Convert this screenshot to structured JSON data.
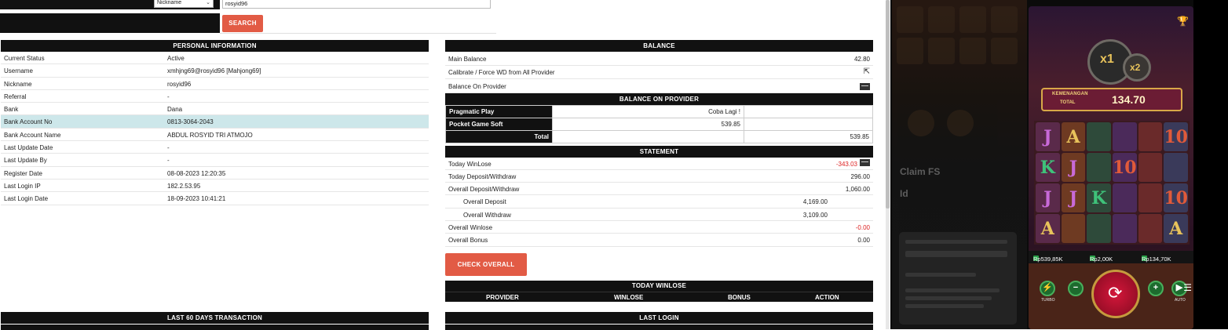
{
  "search": {
    "select_value": "Nickname",
    "input_value": "rosyid96",
    "button_label": "SEARCH"
  },
  "personal": {
    "title": "PERSONAL INFORMATION",
    "rows": [
      {
        "label": "Current Status",
        "value": "Active"
      },
      {
        "label": "Username",
        "value": "xmhjng69@rosyid96  [Mahjong69]"
      },
      {
        "label": "Nickname",
        "value": "rosyid96"
      },
      {
        "label": "Referral",
        "value": "-"
      },
      {
        "label": "Bank",
        "value": "Dana"
      },
      {
        "label": "Bank Account No",
        "value": "0813-3064-2043"
      },
      {
        "label": "Bank Account Name",
        "value": "ABDUL ROSYID TRI ATMOJO"
      },
      {
        "label": "Last Update Date",
        "value": "-"
      },
      {
        "label": "Last Update By",
        "value": "-"
      },
      {
        "label": "Register Date",
        "value": "08-08-2023 12:20:35"
      },
      {
        "label": "Last Login IP",
        "value": "182.2.53.95"
      },
      {
        "label": "Last Login Date",
        "value": "18-09-2023 10:41:21"
      }
    ]
  },
  "balance": {
    "title": "BALANCE",
    "main_label": "Main Balance",
    "main_value": "42.80",
    "calibrate_label": "Calibrate / Force WD from All Provider",
    "on_provider_label": "Balance On Provider",
    "provider_title": "BALANCE ON PROVIDER",
    "providers": [
      {
        "name": "Pragmatic Play",
        "value": "Coba Lagi !",
        "value2": ""
      },
      {
        "name": "Pocket Game Soft",
        "value": "539.85",
        "value2": ""
      }
    ],
    "total_label": "Total",
    "total_value": "539.85"
  },
  "statement": {
    "title": "STATEMENT",
    "today_winlose_label": "Today WinLose",
    "today_winlose_value": "-343.03",
    "today_dw_label": "Today Deposit/Withdraw",
    "today_dw_value": "296.00",
    "overall_dw_label": "Overall Deposit/Withdraw",
    "overall_dw_value": "1,060.00",
    "overall_deposit_label": "Overall Deposit",
    "overall_deposit_value": "4,169.00",
    "overall_withdraw_label": "Overall Withdraw",
    "overall_withdraw_value": "3,109.00",
    "overall_winlose_label": "Overall Winlose",
    "overall_winlose_value": "-0.00",
    "overall_bonus_label": "Overall Bonus",
    "overall_bonus_value": "0.00",
    "check_button": "CHECK OVERALL"
  },
  "today_winlose": {
    "title": "TODAY WINLOSE",
    "columns": [
      "PROVIDER",
      "WINLOSE",
      "BONUS",
      "ACTION"
    ]
  },
  "last60": {
    "title": "LAST 60 DAYS TRANSACTION"
  },
  "last_login": {
    "title": "LAST LOGIN"
  },
  "game": {
    "side_text_1": "Claim FS",
    "side_text_2": "Id",
    "multiplier": "x1",
    "multiplier2": "x2",
    "win_label_1": "KEMENANGAN",
    "win_label_2": "TOTAL",
    "win_amount": "134.70",
    "stat_1": "Rp539,85K",
    "stat_2": "Rp2,00K",
    "stat_3": "Rp134,70K",
    "turbo_label": "TURBO",
    "auto_label": "AUTO",
    "symbols": [
      "J",
      "A",
      "",
      "",
      "",
      "10",
      "K",
      "J",
      "",
      "10",
      "",
      "",
      "J",
      "J",
      "K",
      "",
      "",
      "10",
      "A",
      "",
      "",
      "",
      "",
      "A"
    ],
    "colors": {
      "accent": "#e25b45",
      "header": "#111111",
      "highlight": "#cde7ea",
      "negative": "#dd2222"
    }
  }
}
